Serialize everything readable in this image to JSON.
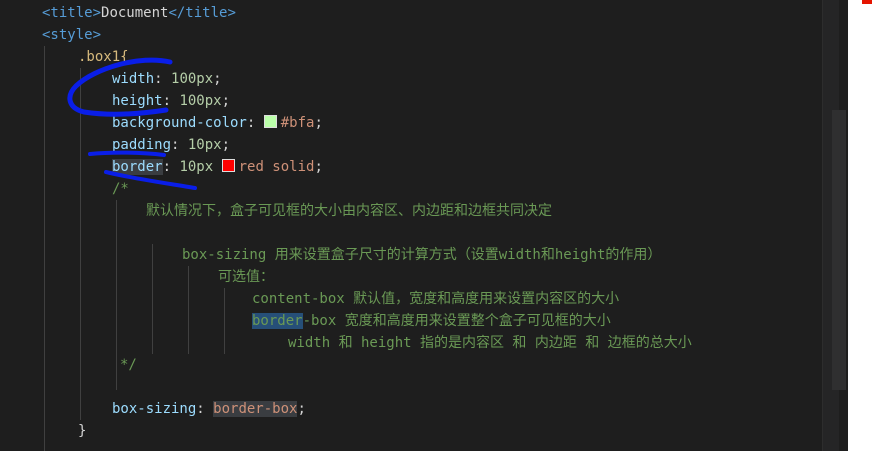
{
  "code": {
    "l1": {
      "open": "<title>",
      "text": "Document",
      "close": "</title>"
    },
    "l2": {
      "open": "<style>"
    },
    "l3": {
      "selector": ".box1{"
    },
    "l4": {
      "prop": "width",
      "colon": ": ",
      "value": "100px",
      "semi": ";"
    },
    "l5": {
      "prop": "height",
      "colon": ": ",
      "value": "100px",
      "semi": ";"
    },
    "l6": {
      "prop": "background-color",
      "colon": ": ",
      "value": "#bfa",
      "semi": ";"
    },
    "l7": {
      "prop": "padding",
      "colon": ": ",
      "value": "10px",
      "semi": ";"
    },
    "l8": {
      "prop": "border",
      "colon": ": ",
      "value_num": "10px ",
      "value_rest": "red solid",
      "semi": ";"
    },
    "l9": {
      "comment": "/*"
    },
    "l10": {
      "comment": "默认情况下，盒子可见框的大小由内容区、内边距和边框共同决定"
    },
    "l11": {
      "comment": "box-sizing 用来设置盒子尺寸的计算方式（设置width和height的作用）"
    },
    "l12": {
      "comment": "可选值："
    },
    "l13": {
      "comment": "content-box 默认值，宽度和高度用来设置内容区的大小"
    },
    "l14": {
      "comment_hl": "border",
      "comment": "-box 宽度和高度用来设置整个盒子可见框的大小"
    },
    "l15": {
      "comment": "width 和 height 指的是内容区 和 内边距 和 边框的总大小"
    },
    "l16": {
      "comment": "*/"
    },
    "l17": {
      "prop": "box-sizing",
      "colon": ": ",
      "value": "border-box",
      "semi": ";"
    },
    "l18": {
      "text": "}"
    }
  },
  "swatches": {
    "bfa": "#bbffaa",
    "red": "#ff0000"
  },
  "colors": {
    "ink": "#0a1ee8",
    "accent": "#e51400"
  }
}
